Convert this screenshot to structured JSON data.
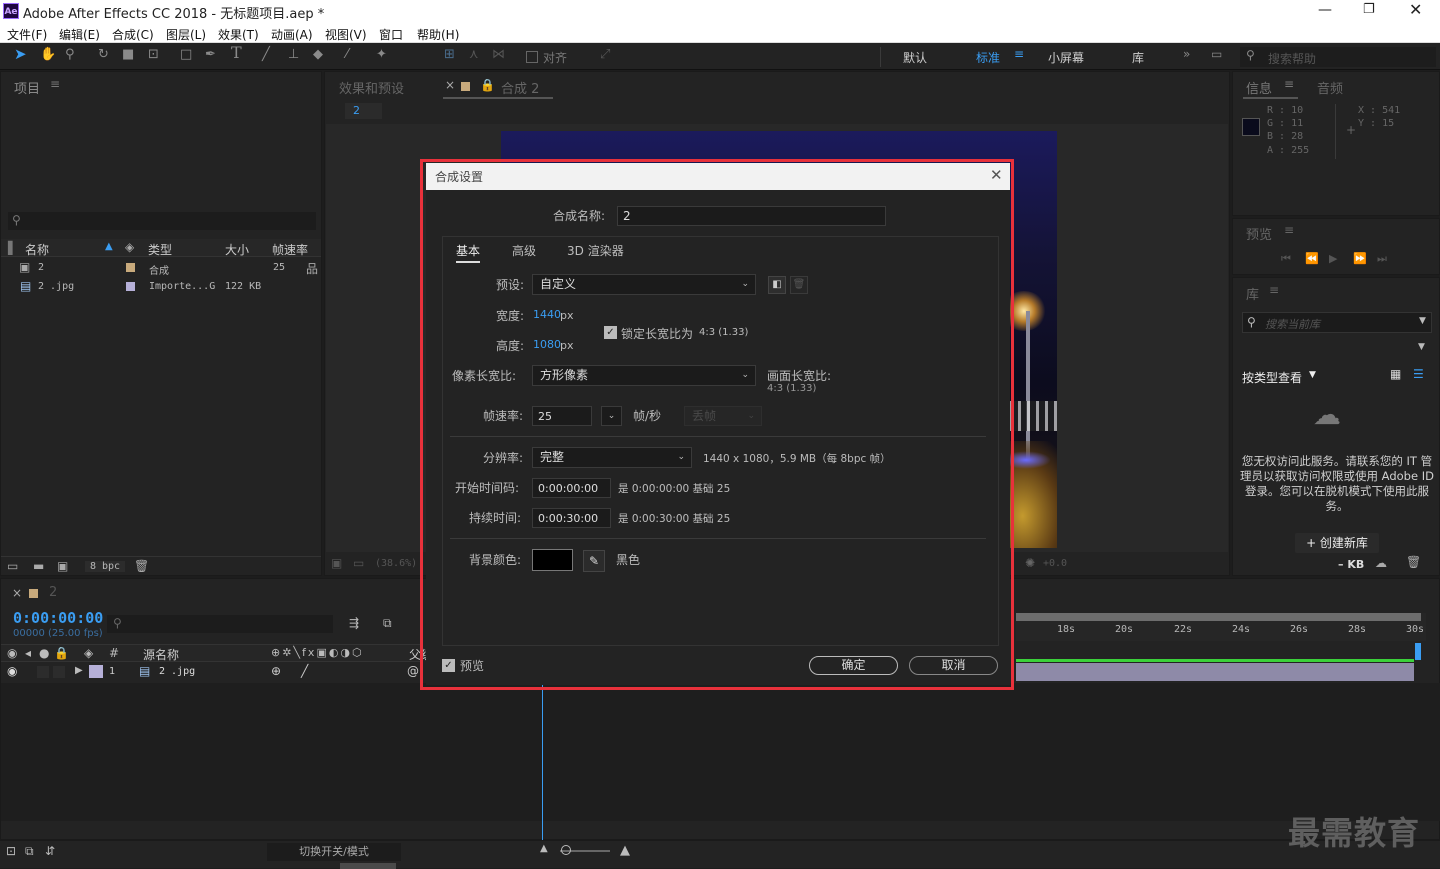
{
  "app": {
    "title": "Adobe After Effects CC 2018 - 无标题项目.aep *",
    "logo": "Ae"
  },
  "menu": [
    "文件(F)",
    "编辑(E)",
    "合成(C)",
    "图层(L)",
    "效果(T)",
    "动画(A)",
    "视图(V)",
    "窗口",
    "帮助(H)"
  ],
  "toolbar": {
    "snap_label": "对齐",
    "workspaces": [
      "默认",
      "标准",
      "小屏幕",
      "库"
    ],
    "active_workspace": "标准",
    "search_placeholder": "搜索帮助"
  },
  "project": {
    "title": "项目",
    "search_placeholder": "",
    "columns": [
      "名称",
      "类型",
      "大小",
      "帧速率"
    ],
    "rows": [
      {
        "name": "2",
        "type": "合成",
        "size": "",
        "fps": "25"
      },
      {
        "name": "2 .jpg",
        "type": "Importe...G",
        "size": "122 KB",
        "fps": ""
      }
    ],
    "bpc": "8 bpc"
  },
  "comp_viewer": {
    "tabs": [
      "效果和预设",
      "合成 2"
    ],
    "flow_tab": "2",
    "zoom": "(38.6%)",
    "offset": "+0.0"
  },
  "info": {
    "tabs": [
      "信息",
      "音频"
    ],
    "r": "R : 10",
    "g": "G : 11",
    "b": "B : 28",
    "a": "A : 255",
    "x": "X : 541",
    "y": "Y : 15",
    "swatch": "#0a0b1c"
  },
  "preview": {
    "title": "预览"
  },
  "library": {
    "title": "库",
    "search_placeholder": "搜索当前库",
    "view_label": "按类型查看",
    "message": "您无权访问此服务。请联系您的 IT 管理员以获取访问权限或使用 Adobe ID 登录。您可以在脱机模式下使用此服务。",
    "create_button": "+ 创建新库",
    "size": "– KB"
  },
  "timeline": {
    "tab": "2",
    "timecode": "0:00:00:00",
    "frames": "00000 (25.00 fps)",
    "search_placeholder": "",
    "col_source": "源名称",
    "col_parent": "父级",
    "layer_num": "1",
    "layer_name": "2 .jpg",
    "ruler": [
      "18s",
      "20s",
      "22s",
      "24s",
      "26s",
      "28s",
      "30s"
    ],
    "toggle_label": "切换开关/模式"
  },
  "dialog": {
    "title": "合成设置",
    "name_label": "合成名称:",
    "name_value": "2",
    "tabs": [
      "基本",
      "高级",
      "3D 渲染器"
    ],
    "active_tab": "基本",
    "preset_label": "预设:",
    "preset_value": "自定义",
    "width_label": "宽度:",
    "width_value": "1440",
    "height_label": "高度:",
    "height_value": "1080",
    "px_unit": "px",
    "lock_label": "锁定长宽比为",
    "lock_ratio": "4:3 (1.33)",
    "par_label": "像素长宽比:",
    "par_value": "方形像素",
    "frame_aspect_label": "画面长宽比:",
    "frame_aspect_value": "4:3 (1.33)",
    "fps_label": "帧速率:",
    "fps_value": "25",
    "fps_unit": "帧/秒",
    "drop_frame": "丢帧",
    "res_label": "分辨率:",
    "res_value": "完整",
    "res_info": "1440 x 1080，5.9 MB（每 8bpc 帧）",
    "start_label": "开始时间码:",
    "start_value": "0:00:00:00",
    "start_info": "是 0:00:00:00  基础 25",
    "dur_label": "持续时间:",
    "dur_value": "0:00:30:00",
    "dur_info": "是 0:00:30:00  基础 25",
    "bg_label": "背景颜色:",
    "bg_color_name": "黑色",
    "bg_color": "#000000",
    "preview_label": "预览",
    "ok": "确定",
    "cancel": "取消",
    "highlight": "#e8313b"
  },
  "watermark": "最需教育"
}
